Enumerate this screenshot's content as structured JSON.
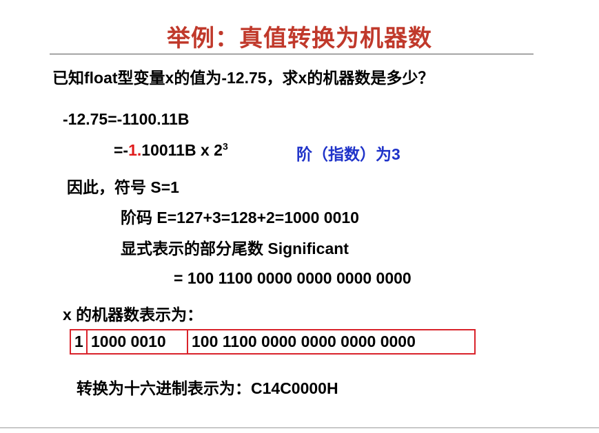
{
  "slide": {
    "title": "举例：真值转换为机器数",
    "question": "已知float型变量x的值为-12.75，求x的机器数是多少？",
    "step1": "-12.75=-1100.11B",
    "step2": {
      "prefix": "=-",
      "highlight": "1.",
      "mantissa": "10011B x 2",
      "exponent": "3",
      "note": "阶（指数）为3"
    },
    "sign_line": "因此，符号 S=1",
    "exponent_line": "阶码 E=127+3=128+2=1000 0010",
    "significand_label": "显式表示的部分尾数 Significant",
    "significand_value": "= 100 1100 0000 0000 0000 0000",
    "machine_label": "x 的机器数表示为：",
    "machine_fields": {
      "sign": "1",
      "exponent": "1000 0010",
      "fraction": "100 1100 0000 0000 0000 0000"
    },
    "hex_line": "转换为十六进制表示为：C14C0000H"
  },
  "colors": {
    "title": "#c0392b",
    "highlight": "#e01b1b",
    "note": "#1f33c9",
    "box_border": "#d9222a"
  }
}
